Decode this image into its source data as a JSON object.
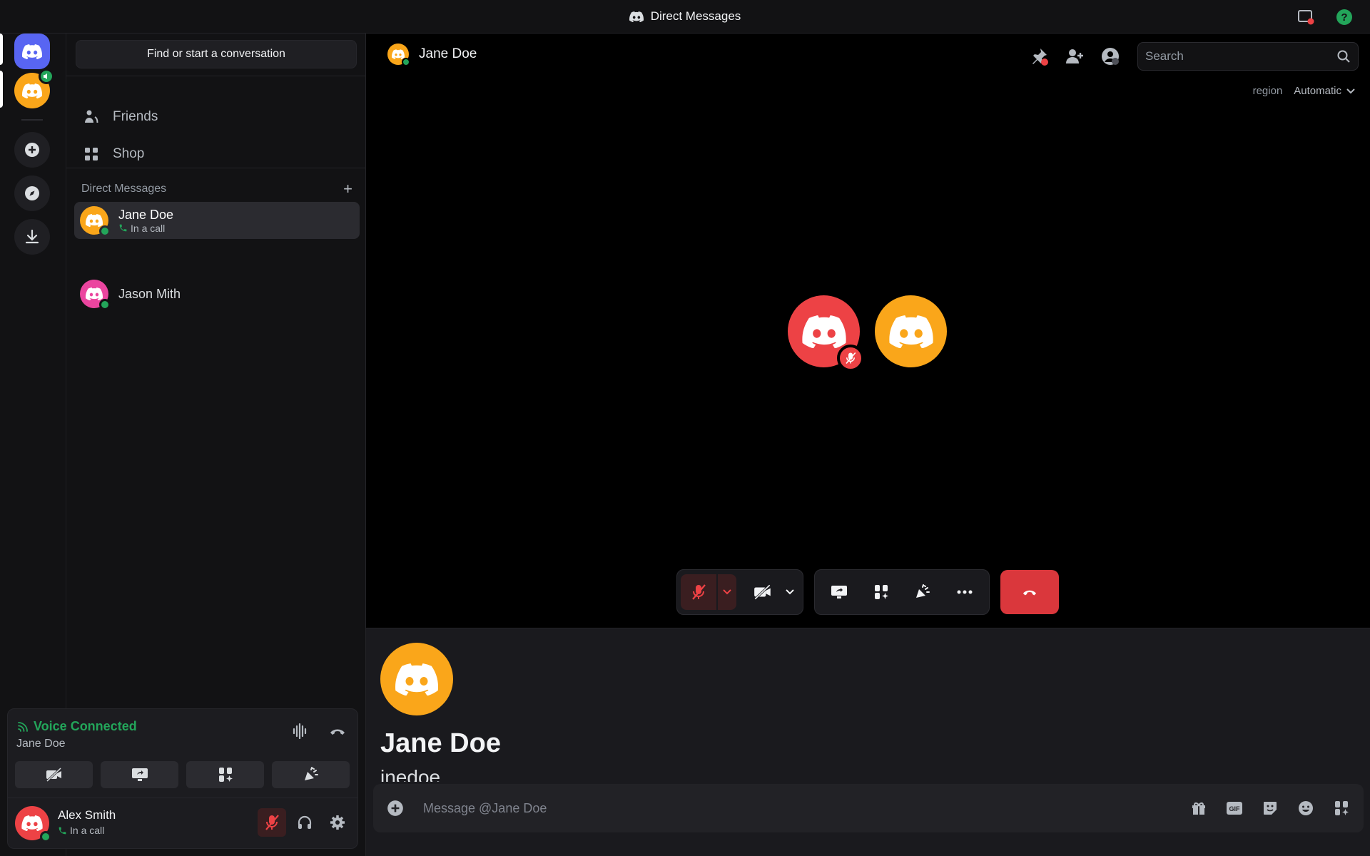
{
  "titlebar": {
    "title": "Direct Messages"
  },
  "sidebar": {
    "find_button": "Find or start a conversation",
    "nav": [
      {
        "label": "Friends"
      },
      {
        "label": "Shop"
      }
    ],
    "dm_header": "Direct Messages",
    "dms": [
      {
        "name": "Jane Doe",
        "status": "In a call",
        "color": "#faa61a"
      },
      {
        "name": "Jason Mith",
        "status": "",
        "color": "#eb459f"
      }
    ]
  },
  "voice": {
    "title": "Voice Connected",
    "channel": "Jane Doe",
    "user": {
      "name": "Alex Smith",
      "status": "In a call"
    }
  },
  "call": {
    "header_name": "Jane Doe",
    "search_placeholder": "Search",
    "region_label": "region",
    "region_value": "Automatic"
  },
  "profile": {
    "name": "Jane Doe",
    "username": "jnedoe",
    "message_placeholder": "Message @Jane Doe"
  },
  "colors": {
    "blurple": "#5865f2",
    "orange": "#faa61a",
    "red": "#ed4245",
    "green": "#23a55a",
    "pink": "#eb459f"
  }
}
